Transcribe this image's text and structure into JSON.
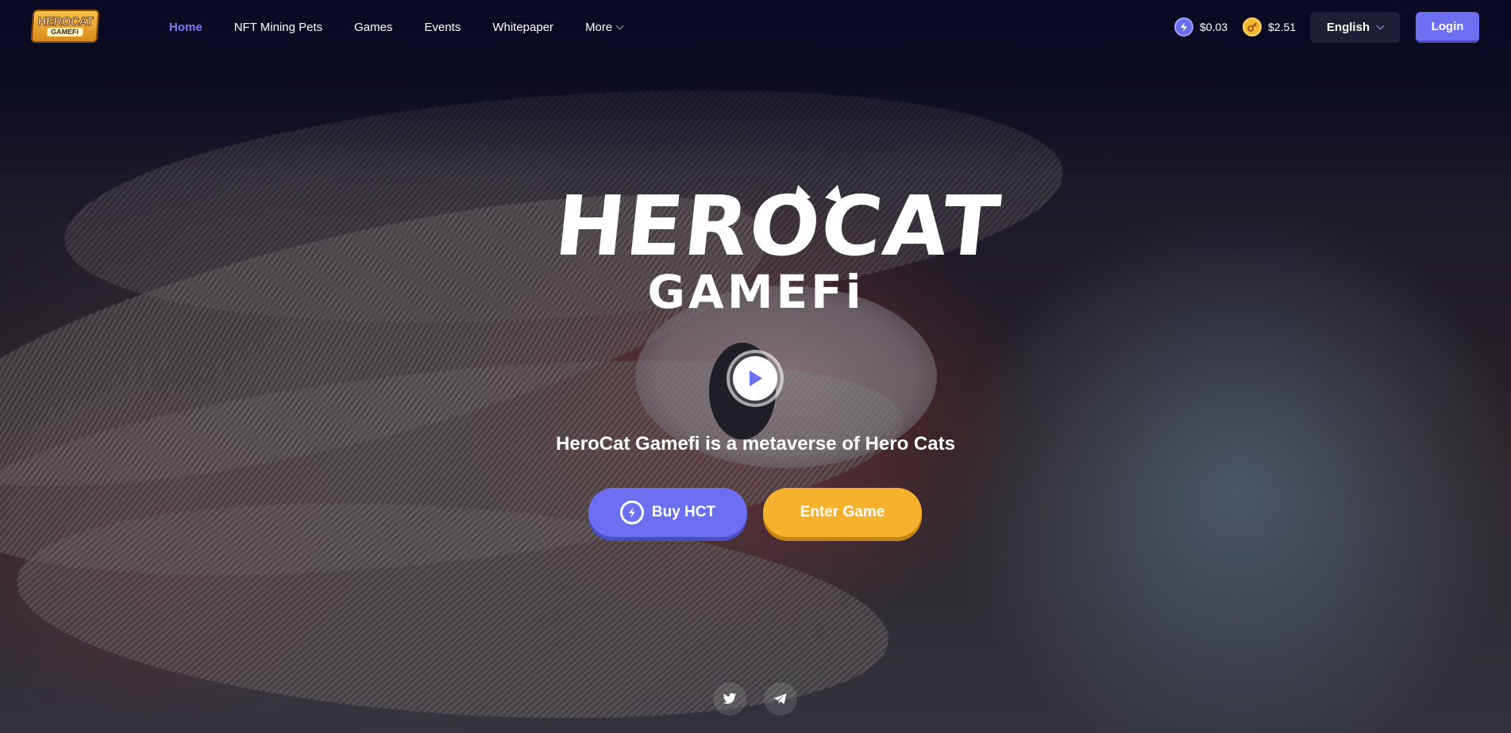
{
  "brand": {
    "logo_top": "HEROCAT",
    "logo_bottom": "GAMEFi",
    "title_line1": "HEROCAT",
    "title_line2": "GAMEFi"
  },
  "nav": {
    "items": [
      {
        "label": "Home",
        "active": true
      },
      {
        "label": "NFT Mining Pets",
        "active": false
      },
      {
        "label": "Games",
        "active": false
      },
      {
        "label": "Events",
        "active": false
      },
      {
        "label": "Whitepaper",
        "active": false
      },
      {
        "label": "More",
        "active": false,
        "has_dropdown": true
      }
    ]
  },
  "prices": [
    {
      "icon": "hct-coin-icon",
      "value": "$0.03"
    },
    {
      "icon": "gold-coin-icon",
      "value": "$2.51"
    }
  ],
  "language": {
    "selected": "English"
  },
  "login_label": "Login",
  "hero": {
    "tagline": "HeroCat Gamefi is a metaverse of Hero Cats",
    "buy_label": "Buy HCT",
    "enter_label": "Enter Game"
  },
  "social": [
    {
      "icon": "twitter-icon"
    },
    {
      "icon": "telegram-icon"
    }
  ],
  "colors": {
    "accent": "#6c6ff0",
    "gold": "#f6b22c",
    "nav_active": "#7b7ff5",
    "background": "#0b0c22"
  }
}
